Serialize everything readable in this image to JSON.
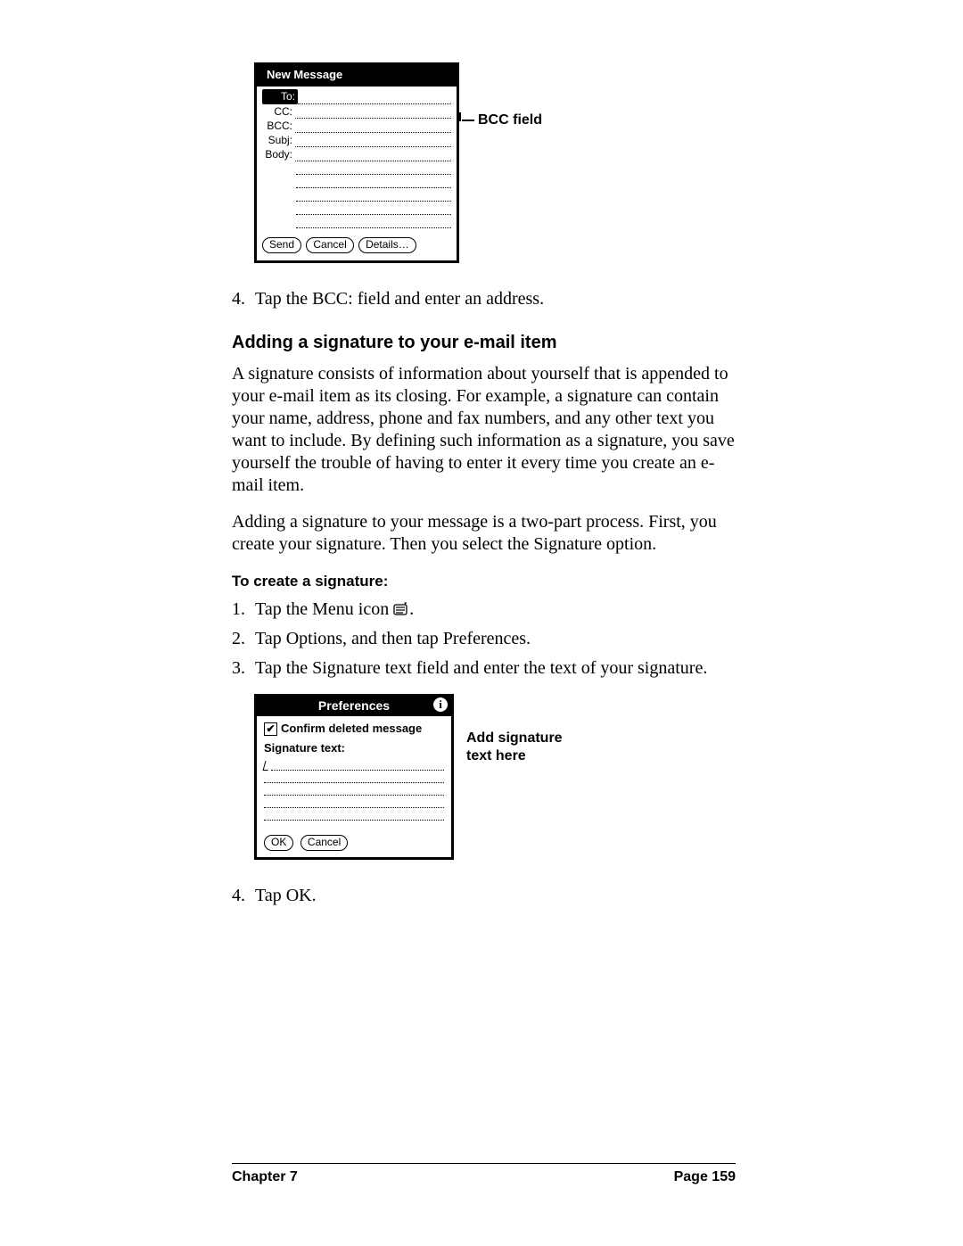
{
  "fig1": {
    "title": "New Message",
    "labels": {
      "to": "To:",
      "cc": "CC:",
      "bcc": "BCC:",
      "subj": "Subj:",
      "body": "Body:"
    },
    "buttons": {
      "send": "Send",
      "cancel": "Cancel",
      "details": "Details…"
    },
    "callout": "BCC field"
  },
  "step4a": {
    "num": "4.",
    "text": "Tap the BCC: field and enter an address."
  },
  "heading1": "Adding a signature to your e-mail item",
  "para1": "A signature consists of information about yourself that is appended to your e-mail item as its closing. For example, a signature can contain your name, address, phone and fax numbers, and any other text you want to include. By defining such information as a signature, you save yourself the trouble of having to enter it every time you create an e-mail item.",
  "para2": "Adding a signature to your message is a two-part process. First, you create your signature. Then you select the Signature option.",
  "subheading1": "To create a signature:",
  "steps_b": {
    "s1": {
      "num": "1.",
      "pre": "Tap the Menu icon ",
      "post": "."
    },
    "s2": {
      "num": "2.",
      "text": "Tap Options, and then tap Preferences."
    },
    "s3": {
      "num": "3.",
      "text": "Tap the Signature text field and enter the text of your signature."
    }
  },
  "fig2": {
    "title": "Preferences",
    "confirm": "Confirm deleted message",
    "siglabel": "Signature text:",
    "buttons": {
      "ok": "OK",
      "cancel": "Cancel"
    },
    "callout_l1": "Add signature",
    "callout_l2": "text here"
  },
  "step4b": {
    "num": "4.",
    "text": "Tap OK."
  },
  "footer": {
    "left": "Chapter 7",
    "right": "Page 159"
  }
}
